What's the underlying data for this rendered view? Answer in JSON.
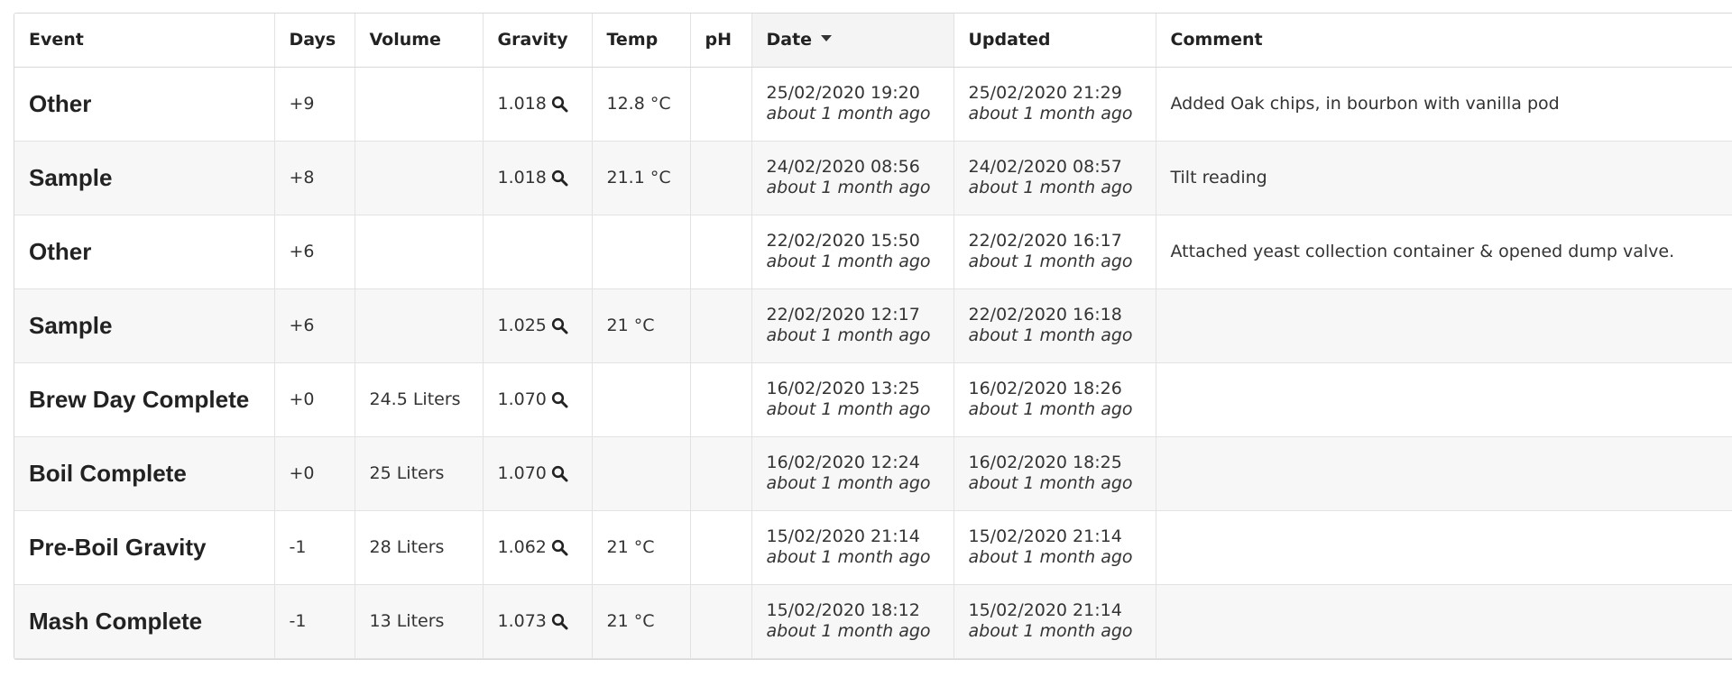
{
  "table": {
    "headers": {
      "event": "Event",
      "days": "Days",
      "volume": "Volume",
      "gravity": "Gravity",
      "temp": "Temp",
      "ph": "pH",
      "date": "Date",
      "updated": "Updated",
      "comment": "Comment"
    },
    "sort": {
      "column": "date",
      "direction": "descending",
      "icon": "caret-down-icon"
    },
    "rows": [
      {
        "event": "Other",
        "days": "+9",
        "volume": "",
        "gravity": "1.018",
        "temp": "12.8 °C",
        "ph": "",
        "date": "25/02/2020 19:20",
        "date_rel": "about 1 month ago",
        "updated": "25/02/2020 21:29",
        "updated_rel": "about 1 month ago",
        "comment": "Added Oak chips, in bourbon with vanilla pod"
      },
      {
        "event": "Sample",
        "days": "+8",
        "volume": "",
        "gravity": "1.018",
        "temp": "21.1 °C",
        "ph": "",
        "date": "24/02/2020 08:56",
        "date_rel": "about 1 month ago",
        "updated": "24/02/2020 08:57",
        "updated_rel": "about 1 month ago",
        "comment": "Tilt reading"
      },
      {
        "event": "Other",
        "days": "+6",
        "volume": "",
        "gravity": "",
        "temp": "",
        "ph": "",
        "date": "22/02/2020 15:50",
        "date_rel": "about 1 month ago",
        "updated": "22/02/2020 16:17",
        "updated_rel": "about 1 month ago",
        "comment": "Attached yeast collection container & opened dump valve."
      },
      {
        "event": "Sample",
        "days": "+6",
        "volume": "",
        "gravity": "1.025",
        "temp": "21 °C",
        "ph": "",
        "date": "22/02/2020 12:17",
        "date_rel": "about 1 month ago",
        "updated": "22/02/2020 16:18",
        "updated_rel": "about 1 month ago",
        "comment": ""
      },
      {
        "event": "Brew Day Complete",
        "days": "+0",
        "volume": "24.5 Liters",
        "gravity": "1.070",
        "temp": "",
        "ph": "",
        "date": "16/02/2020 13:25",
        "date_rel": "about 1 month ago",
        "updated": "16/02/2020 18:26",
        "updated_rel": "about 1 month ago",
        "comment": ""
      },
      {
        "event": "Boil Complete",
        "days": "+0",
        "volume": "25 Liters",
        "gravity": "1.070",
        "temp": "",
        "ph": "",
        "date": "16/02/2020 12:24",
        "date_rel": "about 1 month ago",
        "updated": "16/02/2020 18:25",
        "updated_rel": "about 1 month ago",
        "comment": ""
      },
      {
        "event": "Pre-Boil Gravity",
        "days": "-1",
        "volume": "28 Liters",
        "gravity": "1.062",
        "temp": "21 °C",
        "ph": "",
        "date": "15/02/2020 21:14",
        "date_rel": "about 1 month ago",
        "updated": "15/02/2020 21:14",
        "updated_rel": "about 1 month ago",
        "comment": ""
      },
      {
        "event": "Mash Complete",
        "days": "-1",
        "volume": "13 Liters",
        "gravity": "1.073",
        "temp": "21 °C",
        "ph": "",
        "date": "15/02/2020 18:12",
        "date_rel": "about 1 month ago",
        "updated": "15/02/2020 21:14",
        "updated_rel": "about 1 month ago",
        "comment": ""
      }
    ],
    "gravity_icon": "search-icon",
    "colors": {
      "header_sorted_bg": "#f4f4f4",
      "row_stripe_bg": "#f7f7f7",
      "border": "#e2e2e2",
      "text": "#222222"
    }
  }
}
